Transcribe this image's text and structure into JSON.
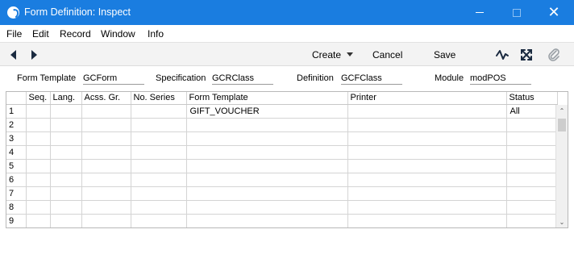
{
  "window": {
    "title": "Form Definition: Inspect",
    "accent_color": "#1a7de0",
    "app_icon": "app-logo-icon",
    "minimize_icon": "minimize-icon",
    "maximize_icon": "maximize-icon",
    "close_glyph": "✕"
  },
  "menu": [
    "File",
    "Edit",
    "Record",
    "Window",
    "Info"
  ],
  "toolbar": {
    "prev_icon": "arrow-left-icon",
    "next_icon": "arrow-right-icon",
    "create_label": "Create",
    "cancel_label": "Cancel",
    "save_label": "Save",
    "icons": [
      "activity-icon",
      "expand-icon",
      "attachment-icon"
    ]
  },
  "header": {
    "form_template": {
      "label": "Form Template",
      "value": "GCForm"
    },
    "specification": {
      "label": "Specification",
      "value": "GCRClass"
    },
    "definition": {
      "label": "Definition",
      "value": "GCFClass"
    },
    "module": {
      "label": "Module",
      "value": "modPOS"
    }
  },
  "grid": {
    "columns": [
      "",
      "Seq.",
      "Lang.",
      "Acss. Gr.",
      "No. Series",
      "Form Template",
      "Printer",
      "Status"
    ],
    "rows": [
      [
        "1",
        "",
        "",
        "",
        "",
        "GIFT_VOUCHER",
        "",
        "All"
      ],
      [
        "2",
        "",
        "",
        "",
        "",
        "",
        "",
        ""
      ],
      [
        "3",
        "",
        "",
        "",
        "",
        "",
        "",
        ""
      ],
      [
        "4",
        "",
        "",
        "",
        "",
        "",
        "",
        ""
      ],
      [
        "5",
        "",
        "",
        "",
        "",
        "",
        "",
        ""
      ],
      [
        "6",
        "",
        "",
        "",
        "",
        "",
        "",
        ""
      ],
      [
        "7",
        "",
        "",
        "",
        "",
        "",
        "",
        ""
      ],
      [
        "8",
        "",
        "",
        "",
        "",
        "",
        "",
        ""
      ],
      [
        "9",
        "",
        "",
        "",
        "",
        "",
        "",
        ""
      ]
    ],
    "scroll_up_glyph": "⌃",
    "scroll_down_glyph": "⌄"
  }
}
